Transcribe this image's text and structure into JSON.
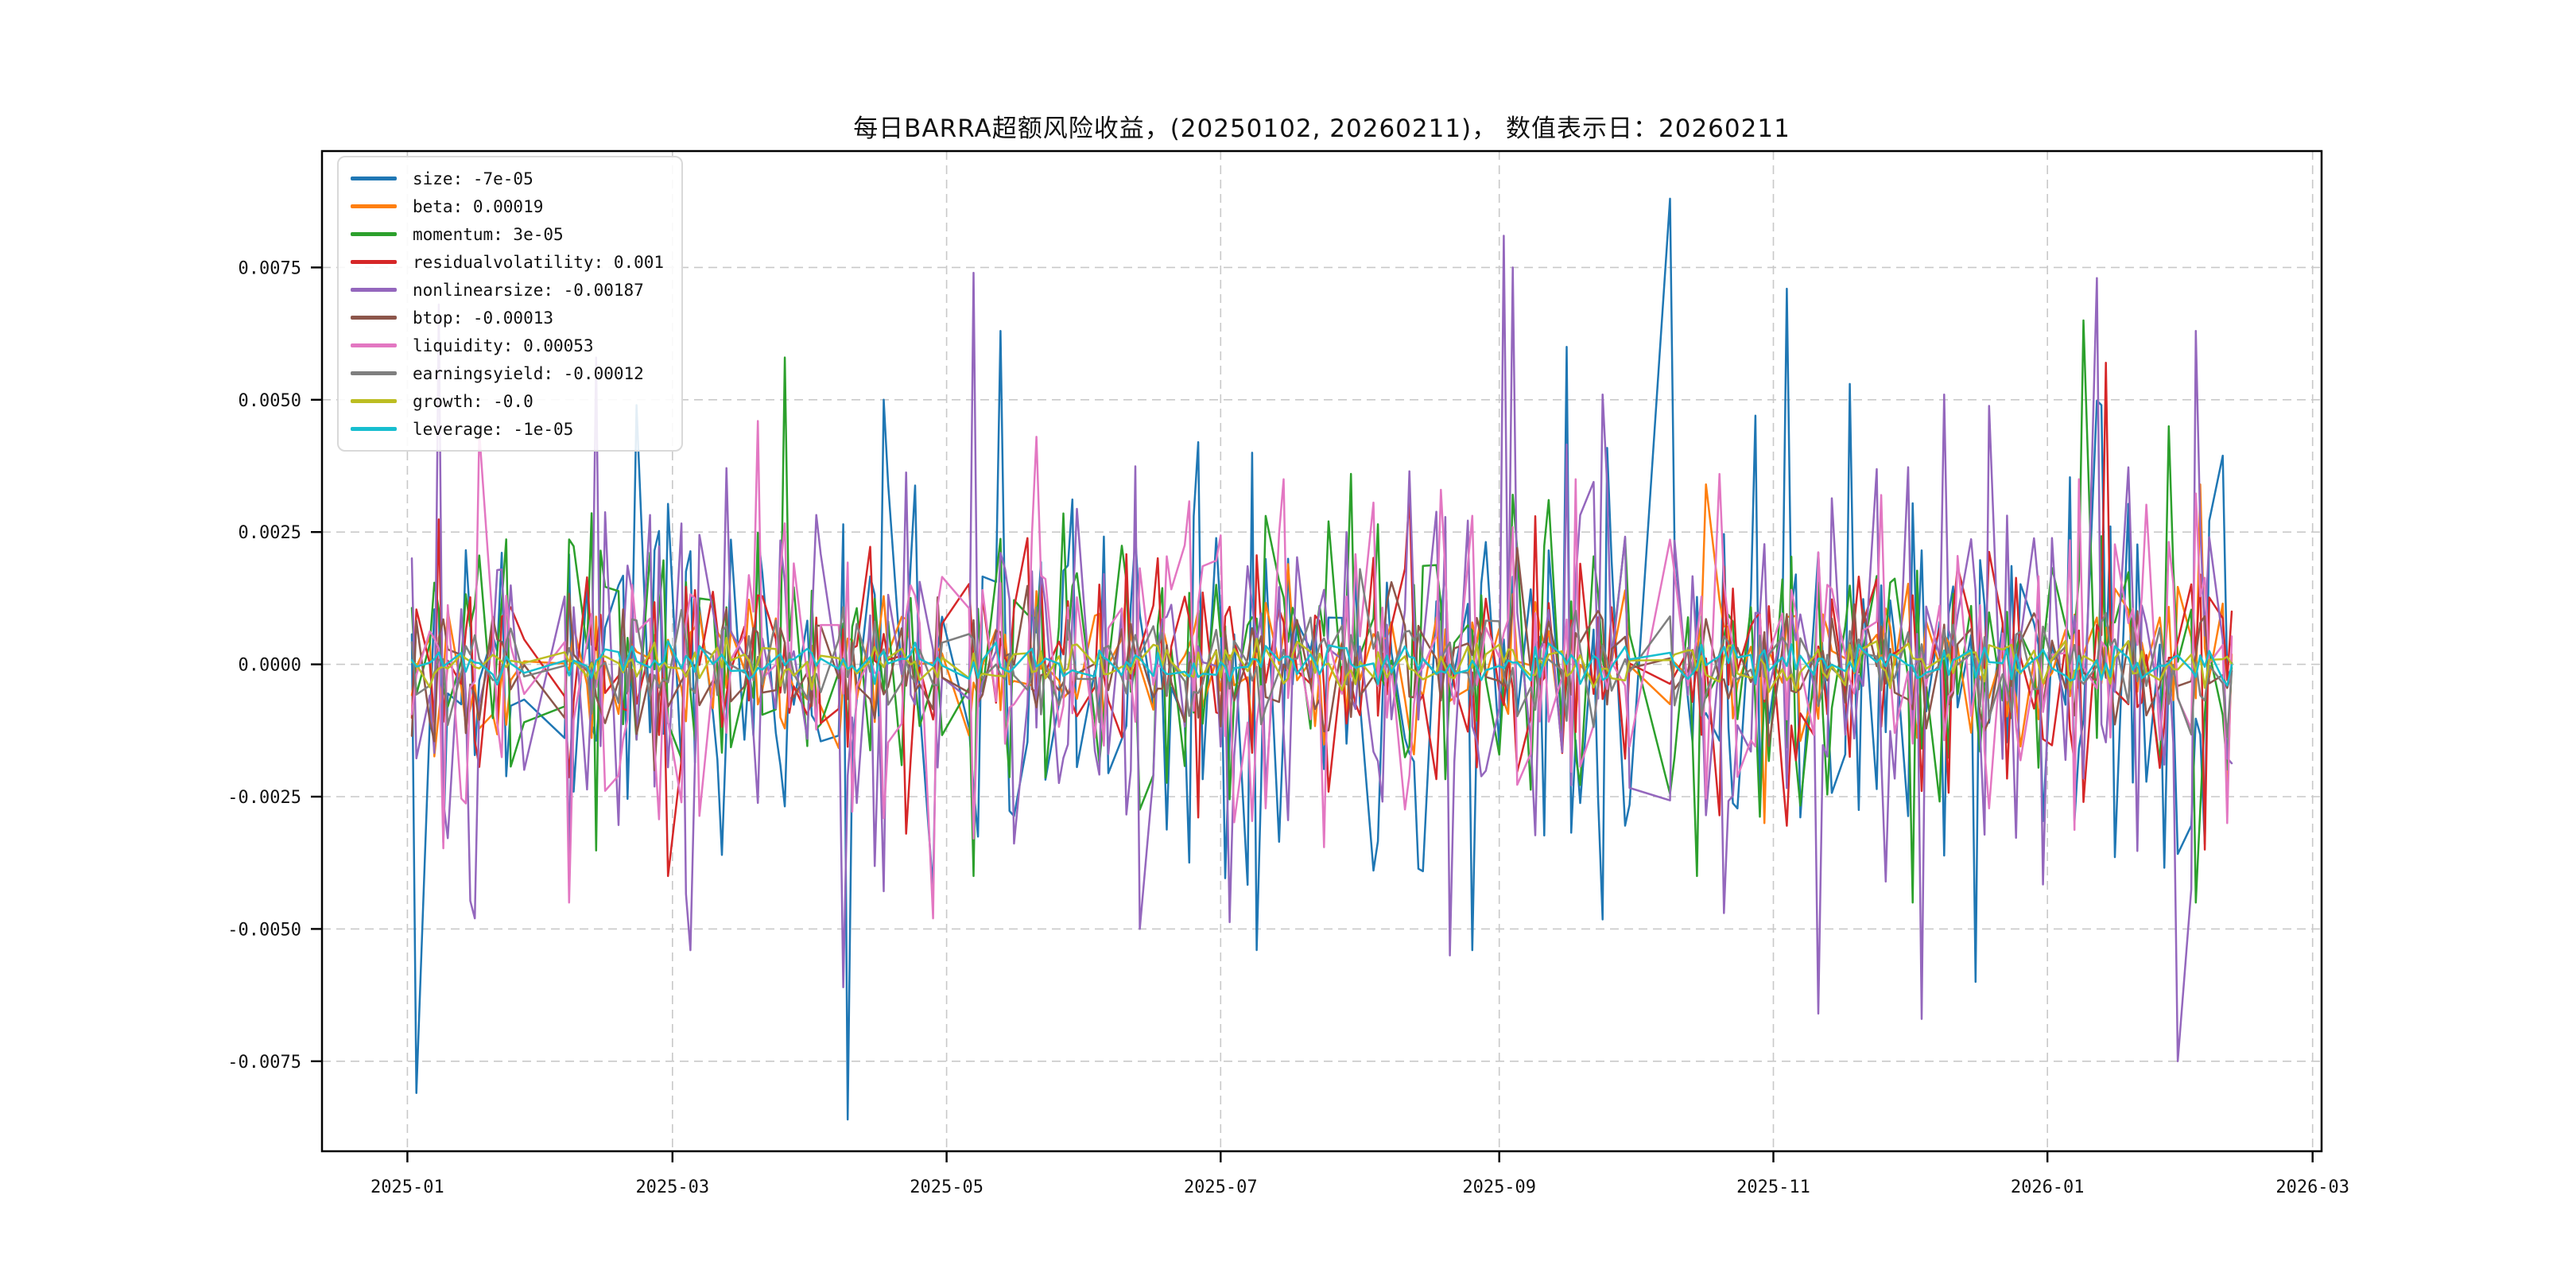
{
  "chart_data": {
    "type": "line",
    "title": "每日BARRA超额风险收益，(20250102, 20260211)， 数值表示日：20260211",
    "data_start": "2025-01-02",
    "data_end": "2026-02-11",
    "x_axis": {
      "range": [
        "2024-12-13",
        "2026-03-03"
      ],
      "ticks": [
        "2025-01",
        "2025-03",
        "2025-05",
        "2025-07",
        "2025-09",
        "2025-11",
        "2026-01",
        "2026-03"
      ]
    },
    "y_axis": {
      "range": [
        -0.0092,
        0.0097
      ],
      "ticks": [
        0.0075,
        0.005,
        0.0025,
        0,
        -0.0025,
        -0.005,
        -0.0075
      ],
      "labels": [
        "0.0075",
        "0.0050",
        "0.0025",
        "0.0000",
        "-0.0025",
        "-0.0050",
        "-0.0075"
      ]
    },
    "grid": {
      "style": "dashed",
      "color": "#c9c9c9"
    },
    "plot_border_color": "#000000",
    "legend_position": "upper left",
    "holidays": [
      [
        "2025-01-28",
        "2025-02-04"
      ],
      [
        "2025-04-04",
        "2025-04-04"
      ],
      [
        "2025-05-01",
        "2025-05-05"
      ],
      [
        "2025-06-02",
        "2025-06-02"
      ],
      [
        "2025-10-01",
        "2025-10-08"
      ],
      [
        "2026-01-01",
        "2026-01-01"
      ]
    ],
    "series": [
      {
        "name": "size",
        "label": "size: -7e-05",
        "color": "#1f77b4",
        "sigma": 0.0019,
        "seed": 11,
        "last": -7e-05,
        "spikes": {
          "2025-01-03": -0.0081,
          "2025-02-21": 0.0049,
          "2025-03-12": -0.0036,
          "2025-04-09": -0.0086,
          "2025-04-17": 0.005,
          "2025-05-13": 0.0063,
          "2025-06-26": 0.0042,
          "2025-07-08": 0.004,
          "2025-08-26": -0.0054,
          "2025-09-16": 0.006,
          "2025-10-09": 0.0088,
          "2025-10-28": 0.0047,
          "2025-11-04": 0.0071,
          "2025-11-18": 0.0053,
          "2025-12-16": -0.006,
          "2026-01-13": 0.0049,
          "2026-02-05": -0.0034
        }
      },
      {
        "name": "beta",
        "label": "beta: 0.00019",
        "color": "#ff7f0e",
        "sigma": 0.0007,
        "seed": 22,
        "last": 0.00019,
        "spikes": {
          "2025-10-17": 0.0034,
          "2025-10-30": -0.003,
          "2026-02-04": 0.0034,
          "2026-02-10": -0.0026
        }
      },
      {
        "name": "momentum",
        "label": "momentum: 3e-05",
        "color": "#2ca02c",
        "sigma": 0.0013,
        "seed": 33,
        "last": 3e-05,
        "spikes": {
          "2025-03-26": 0.0058,
          "2025-05-07": -0.004,
          "2025-07-30": 0.0036,
          "2025-10-15": -0.004,
          "2025-12-02": -0.0045,
          "2026-01-09": 0.0065,
          "2026-01-28": 0.0045,
          "2026-02-03": -0.0045
        }
      },
      {
        "name": "residualvolatility",
        "label": "residualvolatility: 0.001",
        "color": "#d62728",
        "sigma": 0.0012,
        "seed": 44,
        "last": 0.001,
        "spikes": {
          "2025-02-28": -0.004,
          "2025-04-22": -0.0032,
          "2025-08-12": 0.0032,
          "2025-09-09": 0.0028,
          "2026-01-14": 0.0057,
          "2026-02-05": -0.0035
        }
      },
      {
        "name": "nonlinearsize",
        "label": "nonlinearsize: -0.00187",
        "color": "#9467bd",
        "sigma": 0.0019,
        "seed": 55,
        "last": -0.00187,
        "spikes": {
          "2025-01-08": 0.0068,
          "2025-01-16": -0.0048,
          "2025-02-12": 0.0058,
          "2025-03-05": -0.0054,
          "2025-04-08": -0.0061,
          "2025-05-07": 0.0074,
          "2025-06-13": -0.005,
          "2025-08-21": -0.0055,
          "2025-09-02": 0.0081,
          "2025-09-04": 0.0075,
          "2025-09-24": 0.0051,
          "2025-10-21": -0.0047,
          "2025-11-11": -0.0066,
          "2025-12-04": -0.0067,
          "2025-12-09": 0.0051,
          "2026-01-12": 0.0073,
          "2026-01-30": -0.0075,
          "2026-02-03": 0.0063
        }
      },
      {
        "name": "btop",
        "label": "btop: -0.00013",
        "color": "#8c564b",
        "sigma": 0.0006,
        "seed": 66,
        "last": -0.00013,
        "spikes": {
          "2025-02-25": -0.002,
          "2025-09-05": 0.0022
        }
      },
      {
        "name": "liquidity",
        "label": "liquidity: 0.00053",
        "color": "#e377c2",
        "sigma": 0.0014,
        "seed": 77,
        "last": 0.00053,
        "spikes": {
          "2025-01-17": 0.0044,
          "2025-02-06": -0.0045,
          "2025-03-20": 0.0046,
          "2025-04-28": -0.0048,
          "2025-05-21": 0.0043,
          "2025-07-15": 0.0035,
          "2025-08-19": 0.0033,
          "2025-09-18": 0.0035,
          "2025-11-25": 0.0032,
          "2026-01-08": 0.0035,
          "2026-02-10": -0.003
        }
      },
      {
        "name": "earningsyield",
        "label": "earningsyield: -0.00012",
        "color": "#7f7f7f",
        "sigma": 0.0005,
        "seed": 88,
        "last": -0.00012,
        "spikes": {
          "2025-08-01": 0.0018
        }
      },
      {
        "name": "growth",
        "label": "growth: -0.0",
        "color": "#bcbd22",
        "sigma": 0.00022,
        "seed": 99,
        "last": 0,
        "spikes": {}
      },
      {
        "name": "leverage",
        "label": "leverage: -1e-05",
        "color": "#17becf",
        "sigma": 0.00018,
        "seed": 110,
        "last": -1e-05,
        "spikes": {}
      }
    ]
  }
}
